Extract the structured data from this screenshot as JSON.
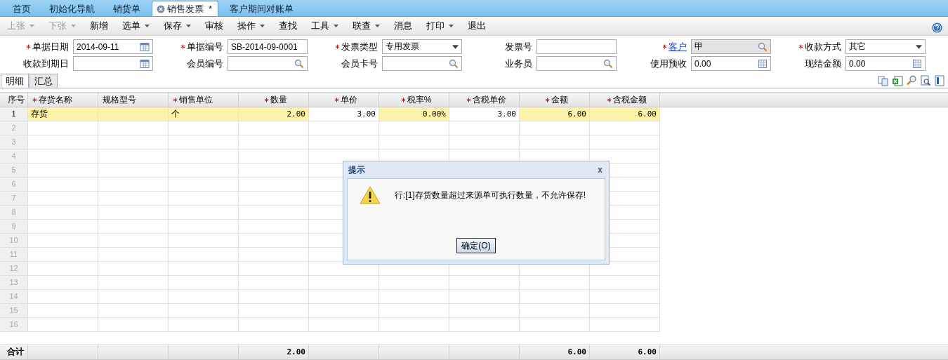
{
  "tabs": [
    {
      "label": "首页",
      "selected": false
    },
    {
      "label": "初始化导航",
      "selected": false
    },
    {
      "label": "销货单",
      "selected": false
    },
    {
      "label": "销售发票",
      "selected": true,
      "suffix": "*"
    },
    {
      "label": "客户期间对账单",
      "selected": false
    }
  ],
  "toolbar": [
    {
      "label": "上张",
      "disabled": true,
      "dropdown": true
    },
    {
      "label": "下张",
      "disabled": true,
      "dropdown": true
    },
    {
      "label": "新增",
      "disabled": false,
      "dropdown": false
    },
    {
      "label": "选单",
      "disabled": false,
      "dropdown": true
    },
    {
      "label": "保存",
      "disabled": false,
      "dropdown": true
    },
    {
      "label": "审核",
      "disabled": false,
      "dropdown": false
    },
    {
      "label": "操作",
      "disabled": false,
      "dropdown": true
    },
    {
      "label": "查找",
      "disabled": false,
      "dropdown": false
    },
    {
      "label": "工具",
      "disabled": false,
      "dropdown": true
    },
    {
      "label": "联查",
      "disabled": false,
      "dropdown": true
    },
    {
      "label": "消息",
      "disabled": false,
      "dropdown": false
    },
    {
      "label": "打印",
      "disabled": false,
      "dropdown": true
    },
    {
      "label": "退出",
      "disabled": false,
      "dropdown": false
    }
  ],
  "form": [
    {
      "label": "单据日期",
      "required": true,
      "link": false,
      "value": "2014-09-11",
      "kind": "date",
      "disabled": false
    },
    {
      "label": "单据编号",
      "required": true,
      "link": false,
      "value": "SB-2014-09-0001",
      "kind": "text",
      "disabled": false
    },
    {
      "label": "发票类型",
      "required": true,
      "link": false,
      "value": "专用发票",
      "kind": "select",
      "disabled": false
    },
    {
      "label": "发票号",
      "required": false,
      "link": false,
      "kind": "text",
      "disabled": false
    },
    {
      "label": "客户",
      "required": true,
      "link": true,
      "value": "甲",
      "kind": "lookup",
      "disabled": true
    },
    {
      "label": "收款方式",
      "required": true,
      "link": false,
      "value": "其它",
      "kind": "select",
      "disabled": false
    },
    {
      "label": "收款到期日",
      "required": false,
      "link": false,
      "kind": "date",
      "disabled": false
    },
    {
      "label": "会员编号",
      "required": false,
      "link": false,
      "kind": "lookup",
      "disabled": false
    },
    {
      "label": "会员卡号",
      "required": false,
      "link": false,
      "kind": "lookup",
      "disabled": false
    },
    {
      "label": "业务员",
      "required": false,
      "link": false,
      "kind": "lookup",
      "disabled": false
    },
    {
      "label": "使用预收",
      "required": false,
      "link": false,
      "value": "0.00",
      "kind": "number",
      "disabled": false
    },
    {
      "label": "现结金额",
      "required": false,
      "link": false,
      "value": "0.00",
      "kind": "number",
      "disabled": false
    }
  ],
  "sub_tabs": [
    {
      "label": "明细",
      "selected": true
    },
    {
      "label": "汇总",
      "selected": false
    }
  ],
  "grid": {
    "columns": [
      {
        "label": "序号",
        "required": false,
        "highlight": false
      },
      {
        "label": "存货名称",
        "required": true,
        "highlight": true
      },
      {
        "label": "规格型号",
        "required": false,
        "highlight": true
      },
      {
        "label": "销售单位",
        "required": true,
        "highlight": true
      },
      {
        "label": "数量",
        "required": true,
        "highlight": true
      },
      {
        "label": "单价",
        "required": true,
        "highlight": false
      },
      {
        "label": "税率%",
        "required": true,
        "highlight": true
      },
      {
        "label": "含税单价",
        "required": true,
        "highlight": false
      },
      {
        "label": "金额",
        "required": true,
        "highlight": true
      },
      {
        "label": "含税金额",
        "required": true,
        "highlight": true
      }
    ],
    "rows": [
      {
        "selected": true,
        "cells": [
          "1",
          "存货",
          null,
          "个",
          "2.00",
          "3.00",
          "0.00%",
          "3.00",
          "6.00",
          "6.00"
        ]
      },
      {
        "selected": false,
        "cells": [
          "2"
        ]
      },
      {
        "selected": false,
        "cells": [
          "3"
        ]
      },
      {
        "selected": false,
        "cells": [
          "4"
        ]
      },
      {
        "selected": false,
        "cells": [
          "5"
        ]
      },
      {
        "selected": false,
        "cells": [
          "6"
        ]
      },
      {
        "selected": false,
        "cells": [
          "7"
        ]
      },
      {
        "selected": false,
        "cells": [
          "8"
        ]
      },
      {
        "selected": false,
        "cells": [
          "9"
        ]
      },
      {
        "selected": false,
        "cells": [
          "10"
        ]
      },
      {
        "selected": false,
        "cells": [
          "11"
        ]
      },
      {
        "selected": false,
        "cells": [
          "12"
        ]
      },
      {
        "selected": false,
        "cells": [
          "13"
        ]
      },
      {
        "selected": false,
        "cells": [
          "14"
        ]
      },
      {
        "selected": false,
        "cells": [
          "15"
        ]
      },
      {
        "selected": false,
        "cells": [
          "16"
        ]
      }
    ],
    "total": {
      "label": "合计",
      "quantity": "2.00",
      "amount": "6.00",
      "amount_with_tax": "6.00"
    }
  },
  "dialog": {
    "title": "提示",
    "close": "x",
    "message": "行:[1]存货数量超过来源单可执行数量，不允许保存!",
    "button": "确定(O)"
  }
}
